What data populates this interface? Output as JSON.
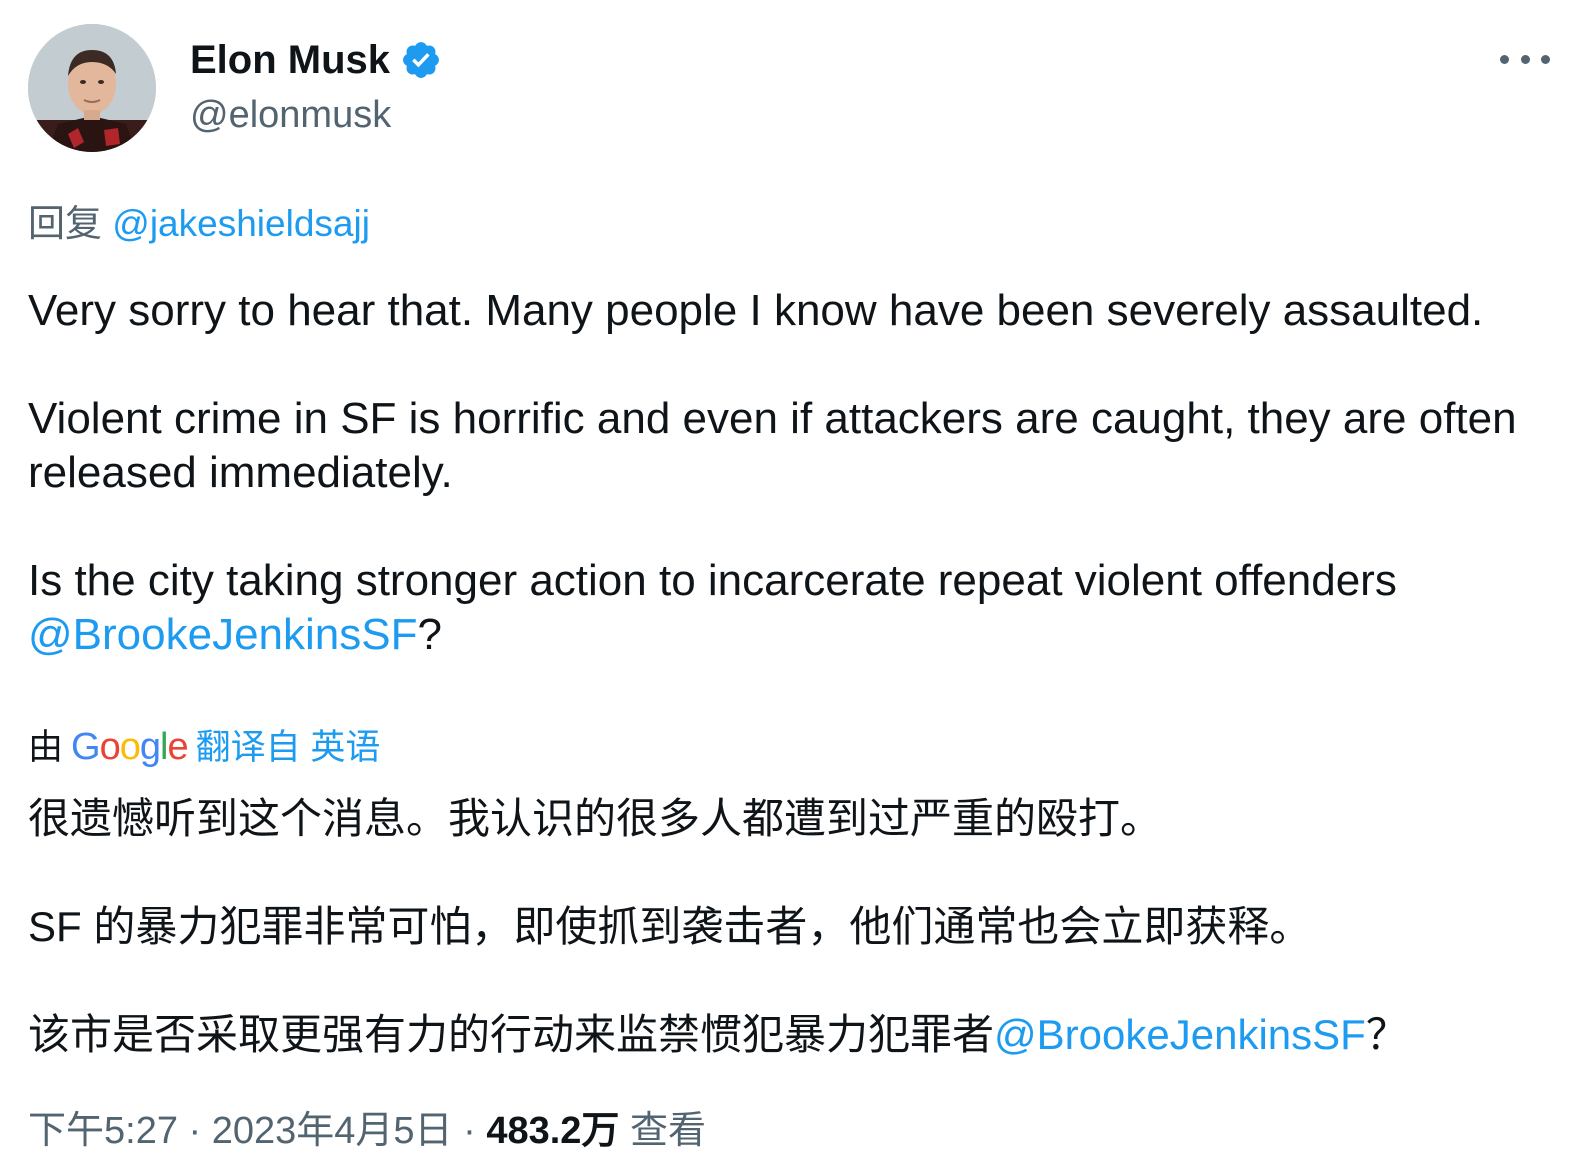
{
  "author": {
    "name": "Elon Musk",
    "handle": "@elonmusk",
    "verified": true,
    "verified_color": "#1d9bf0"
  },
  "more_icon": "ellipsis-icon",
  "reply": {
    "prefix": "回复",
    "to": "@jakeshieldsajj"
  },
  "tweet": {
    "p1": "Very sorry to hear that. Many people I know have been severely assaulted.",
    "p2": "Violent crime in SF is horrific and even if attackers are caught, they are often released immediately.",
    "p3_text": "Is the city taking stronger action to incarcerate repeat violent offenders ",
    "p3_mention": "@BrookeJenkinsSF",
    "p3_end": "?"
  },
  "translation": {
    "by": "由",
    "provider": "Google",
    "label": "翻译自 英语",
    "p1": "很遗憾听到这个消息。我认识的很多人都遭到过严重的殴打。",
    "p2": "SF 的暴力犯罪非常可怕，即使抓到袭击者，他们通常也会立即获释。",
    "p3_text": "该市是否采取更强有力的行动来监禁惯犯暴力犯罪者",
    "p3_mention": "@BrookeJenkinsSF",
    "p3_end": "？"
  },
  "meta": {
    "time": "下午5:27",
    "date": "2023年4月5日",
    "sep": "·",
    "views": "483.2万",
    "views_label": "查看"
  },
  "colors": {
    "link": "#1d9bf0",
    "secondary": "#536471",
    "text": "#0f1419"
  }
}
